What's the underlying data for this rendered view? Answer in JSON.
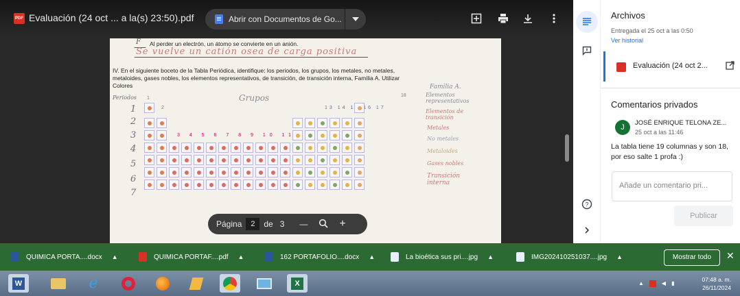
{
  "viewer": {
    "title": "Evaluación (24 oct ... a la(s) 23:50).pdf",
    "open_with_label": "Abrir con Documentos de Go...",
    "pdf_badge": "PDF"
  },
  "paper": {
    "q1_letter": "F",
    "q1_text": "Al perder un electrón, un átomo se convierte en un anión.",
    "q1_answer": "Se vuelve un catión osea de carga positiva",
    "q4_line1": "IV. En el siguiente boceto de la Tabla Periódica, identifique: los periodos, los grupos, los metales, no metales,",
    "q4_line2": "metaloides, gases nobles, los elementos representativos, de transición, de transición interna, Familia A. Utilizar",
    "q4_line3": "Colores",
    "periodos_label": "Periodos",
    "grupos_label": "Grupos",
    "periods": [
      "1",
      "2",
      "3",
      "4",
      "5",
      "6",
      "7"
    ],
    "group_numbers_b": "3 4 5 6 7 8 9 10 11 12",
    "group_numbers_a": "13 14 15 16 17",
    "group_18": "18",
    "group_1": "1",
    "group_2": "2",
    "legend": {
      "familia_a": "Familia A.",
      "representativos": "Elementos representativos",
      "transicion": "Elementos de transición",
      "metales": "Metales",
      "no_metales": "No metales",
      "metaloides": "Metaloides",
      "gases_nobles": "Gases nobles",
      "transicion_interna": "Transición interna"
    }
  },
  "page_nav": {
    "label": "Página",
    "current": "2",
    "of": "de",
    "total": "3",
    "minus": "—",
    "plus": "+"
  },
  "side_panel": {
    "title": "Archivos",
    "submitted": "Entregada el 25 oct a las 0:50",
    "history_link": "Ver historial",
    "file_name": "Evaluación (24 oct 2...",
    "comments_title": "Comentarios privados",
    "avatar_letter": "J",
    "commenter": "JOSÉ ENRIQUE TELONA ZE...",
    "comment_time": "25 oct a las 11:46",
    "comment_text": "La tabla tiene 19 columnas y son 18, por eso salte 1 profa :)",
    "comment_placeholder": "Añade un comentario pri...",
    "post_label": "Publicar"
  },
  "downloads": {
    "items": [
      {
        "name": "QUIMICA PORTA....docx",
        "type": "docx"
      },
      {
        "name": "QUIMICA PORTAF....pdf",
        "type": "pdf"
      },
      {
        "name": "162 PORTAFOLIO....docx",
        "type": "docx"
      },
      {
        "name": "La bioética sus pri....jpg",
        "type": "jpg"
      },
      {
        "name": "IMG202410251037....jpg",
        "type": "jpg"
      }
    ],
    "show_all": "Mostrar todo",
    "close": "✕"
  },
  "taskbar": {
    "time": "07:48 a. m.",
    "date": "26/11/2024"
  },
  "colors": {
    "downloads_bar": "#2c6a33",
    "accent": "#1a73e8",
    "pdf_red": "#d93025"
  }
}
